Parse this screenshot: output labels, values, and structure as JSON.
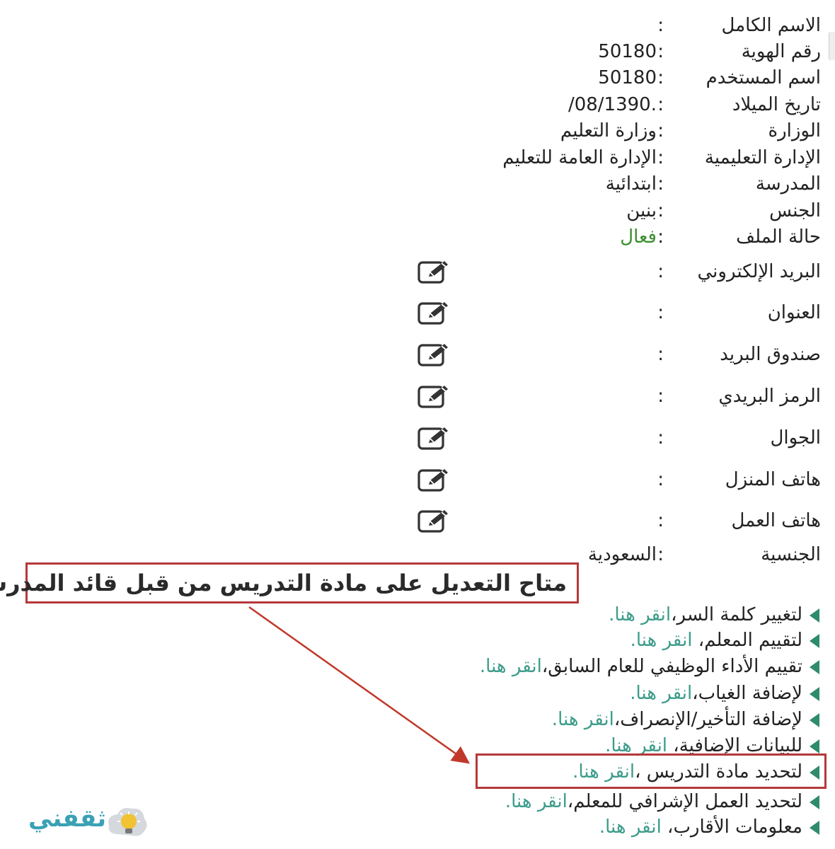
{
  "profile": {
    "full_name": {
      "label": "الاسم الكامل",
      "value": ""
    },
    "id_number": {
      "label": "رقم الهوية",
      "value": "50180"
    },
    "username": {
      "label": "اسم المستخدم",
      "value": "50180"
    },
    "birth_date": {
      "label": "تاريخ الميلاد",
      "value": "/08/1390."
    },
    "ministry": {
      "label": "الوزارة",
      "value": "وزارة التعليم"
    },
    "edu_admin": {
      "label": "الإدارة التعليمية",
      "value": "الإدارة العامة للتعليم"
    },
    "school": {
      "label": "المدرسة",
      "value": "ابتدائية"
    },
    "gender": {
      "label": "الجنس",
      "value": "بنين"
    },
    "file_status": {
      "label": "حالة الملف",
      "value": "فعال"
    },
    "email": {
      "label": "البريد الإلكتروني",
      "value": ""
    },
    "address": {
      "label": "العنوان",
      "value": ""
    },
    "po_box": {
      "label": "صندوق البريد",
      "value": ""
    },
    "postal_code": {
      "label": "الرمز البريدي",
      "value": ""
    },
    "mobile": {
      "label": "الجوال",
      "value": ""
    },
    "home_phone": {
      "label": "هاتف المنزل",
      "value": ""
    },
    "work_phone": {
      "label": "هاتف العمل",
      "value": ""
    },
    "nationality": {
      "label": "الجنسية",
      "value": "السعودية"
    }
  },
  "colon": ":",
  "annotation": "متاح التعديل على مادة التدريس من قبل قائد المدرسة",
  "links": [
    {
      "text": "لتغيير كلمة السر،",
      "link": "انقر هنا."
    },
    {
      "text": "لتقييم المعلم، ",
      "link": "انقر هنا."
    },
    {
      "text": "تقييم الأداء الوظيفي للعام السابق،",
      "link": "انقر هنا."
    },
    {
      "text": "لإضافة الغياب،",
      "link": "انقر هنا."
    },
    {
      "text": "لإضافة التأخير/الإنصراف،",
      "link": "انقر هنا."
    },
    {
      "text": "للبيانات الإضافية، ",
      "link": "انقر هنا."
    },
    {
      "text": "لتحديد مادة التدريس ،",
      "link": "انقر هنا."
    },
    {
      "text": "لتحديد العمل الإشرافي للمعلم،",
      "link": "انقر هنا."
    },
    {
      "text": "معلومات الأقارب، ",
      "link": "انقر هنا."
    }
  ],
  "watermark": "ثقفني",
  "colors": {
    "active": "#3b8e2f",
    "link": "#3c9c8a",
    "highlight": "#b5383a",
    "bullet": "#2e8b6b"
  }
}
